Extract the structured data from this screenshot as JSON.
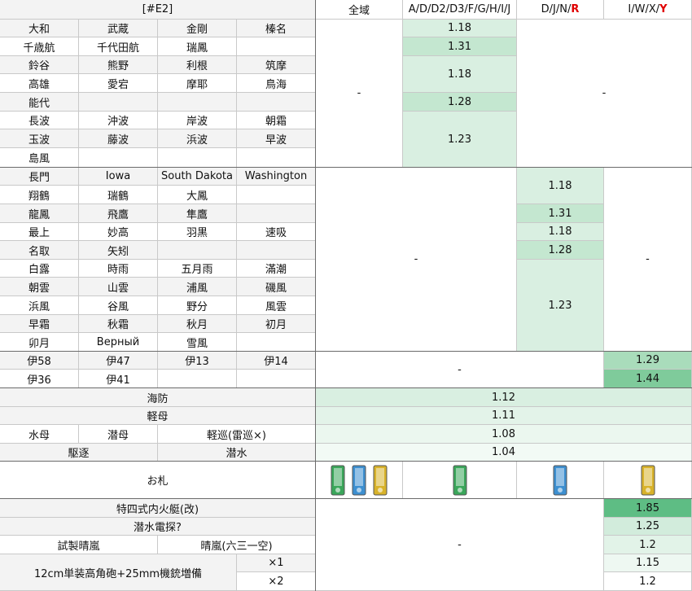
{
  "header": {
    "title": "[#E2]",
    "col_all": "全域",
    "col_a": "A/D/D2/D3/F/G/H/I/J",
    "col_d_prefix": "D/J/N/",
    "col_d_suffix": "R",
    "col_i_prefix": "I/W/X/",
    "col_i_suffix": "Y"
  },
  "ships": [
    [
      "大和",
      "武蔵",
      "金剛",
      "榛名"
    ],
    [
      "千歳航",
      "千代田航",
      "瑞鳳",
      ""
    ],
    [
      "鈴谷",
      "熊野",
      "利根",
      "筑摩"
    ],
    [
      "高雄",
      "愛宕",
      "摩耶",
      "鳥海"
    ],
    [
      "能代",
      "",
      "",
      ""
    ],
    [
      "長波",
      "沖波",
      "岸波",
      "朝霜"
    ],
    [
      "玉波",
      "藤波",
      "浜波",
      "早波"
    ],
    [
      "島風",
      "",
      "",
      ""
    ],
    [
      "長門",
      "Iowa",
      "South Dakota",
      "Washington"
    ],
    [
      "翔鶴",
      "瑞鶴",
      "大鳳",
      ""
    ],
    [
      "龍鳳",
      "飛鷹",
      "隼鷹",
      ""
    ],
    [
      "最上",
      "妙高",
      "羽黒",
      "速吸"
    ],
    [
      "名取",
      "矢矧",
      "",
      ""
    ],
    [
      "白露",
      "時雨",
      "五月雨",
      "滿潮"
    ],
    [
      "朝雲",
      "山雲",
      "浦風",
      "磯風"
    ],
    [
      "浜風",
      "谷風",
      "野分",
      "風雲"
    ],
    [
      "早霜",
      "秋霜",
      "秋月",
      "初月"
    ],
    [
      "卯月",
      "Верный",
      "雪風",
      ""
    ],
    [
      "伊58",
      "伊47",
      "伊13",
      "伊14"
    ],
    [
      "伊36",
      "伊41",
      "",
      ""
    ]
  ],
  "groupA": {
    "all": "-",
    "right": "-",
    "values": [
      "1.18",
      "1.31",
      "1.18",
      "1.28",
      "1.23"
    ]
  },
  "groupB": {
    "all": "-",
    "a": "-",
    "right": "-",
    "values": [
      "1.18",
      "1.31",
      "1.18",
      "1.28",
      "1.23"
    ]
  },
  "groupC": {
    "left": "-",
    "values": [
      "1.29",
      "1.44"
    ]
  },
  "types": [
    {
      "label": "海防",
      "value": "1.12"
    },
    {
      "label": "軽母",
      "value": "1.11"
    },
    {
      "labels": [
        "水母",
        "潜母",
        "軽巡(雷巡×)"
      ],
      "value": "1.08"
    },
    {
      "labels": [
        "駆逐",
        "潜水"
      ],
      "value": "1.04"
    }
  ],
  "ofuda": {
    "label": "お札"
  },
  "equip": {
    "items": [
      "特四式内火艇(改)",
      "潜水電探?",
      "試製晴嵐",
      "晴嵐(六三一空)",
      "12cm単装高角砲+25mm機銃増備"
    ],
    "counts": [
      "×1",
      "×2"
    ],
    "left": "-",
    "values": [
      "1.85",
      "1.25",
      "1.2",
      "1.15",
      "1.2"
    ]
  },
  "colors": {
    "g1": "#e8f5ed",
    "g2": "#d9efe1",
    "g3": "#c4e7d0",
    "g4": "#a9dcbb",
    "g5": "#5ebd84",
    "tag_green": "#3aa65a",
    "tag_blue": "#3d8fd0",
    "tag_yellow": "#d8b22a"
  }
}
